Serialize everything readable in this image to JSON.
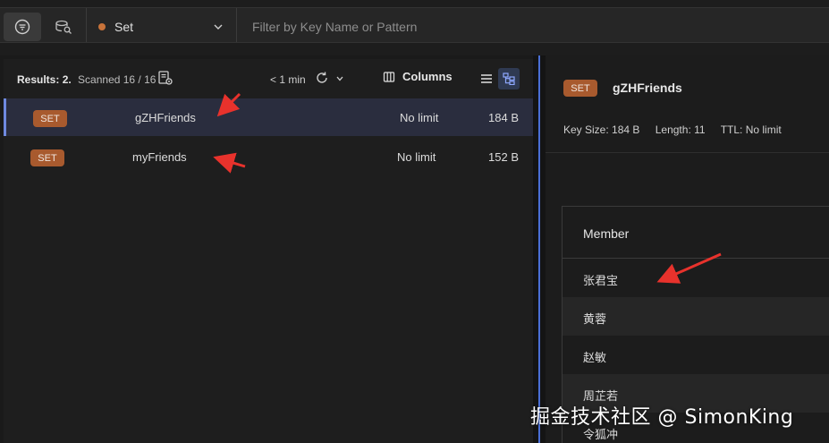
{
  "toolbar": {
    "type_filter": {
      "label": "Set",
      "dot_color": "#c8733a"
    },
    "search": {
      "placeholder": "Filter by Key Name or Pattern",
      "value": ""
    }
  },
  "results": {
    "label": "Results:",
    "count": "2.",
    "scanned": "Scanned 16 / 16",
    "refresh_time": "< 1 min",
    "columns_label": "Columns"
  },
  "keys": [
    {
      "type": "SET",
      "name": "gZHFriends",
      "ttl": "No limit",
      "size": "184 B",
      "selected": true
    },
    {
      "type": "SET",
      "name": "myFriends",
      "ttl": "No limit",
      "size": "152 B",
      "selected": false
    }
  ],
  "detail": {
    "type": "SET",
    "name": "gZHFriends",
    "key_size": "Key Size: 184 B",
    "length": "Length: 11",
    "ttl": "TTL:  No limit",
    "column_header": "Member",
    "members": [
      "张君宝",
      "黄蓉",
      "赵敏",
      "周芷若",
      "令狐冲"
    ]
  },
  "colors": {
    "accent": "#4a6fd6",
    "set_badge": "#a85a2e",
    "arrow": "#e8322c"
  },
  "watermark": "掘金技术社区 @ SimonKing"
}
